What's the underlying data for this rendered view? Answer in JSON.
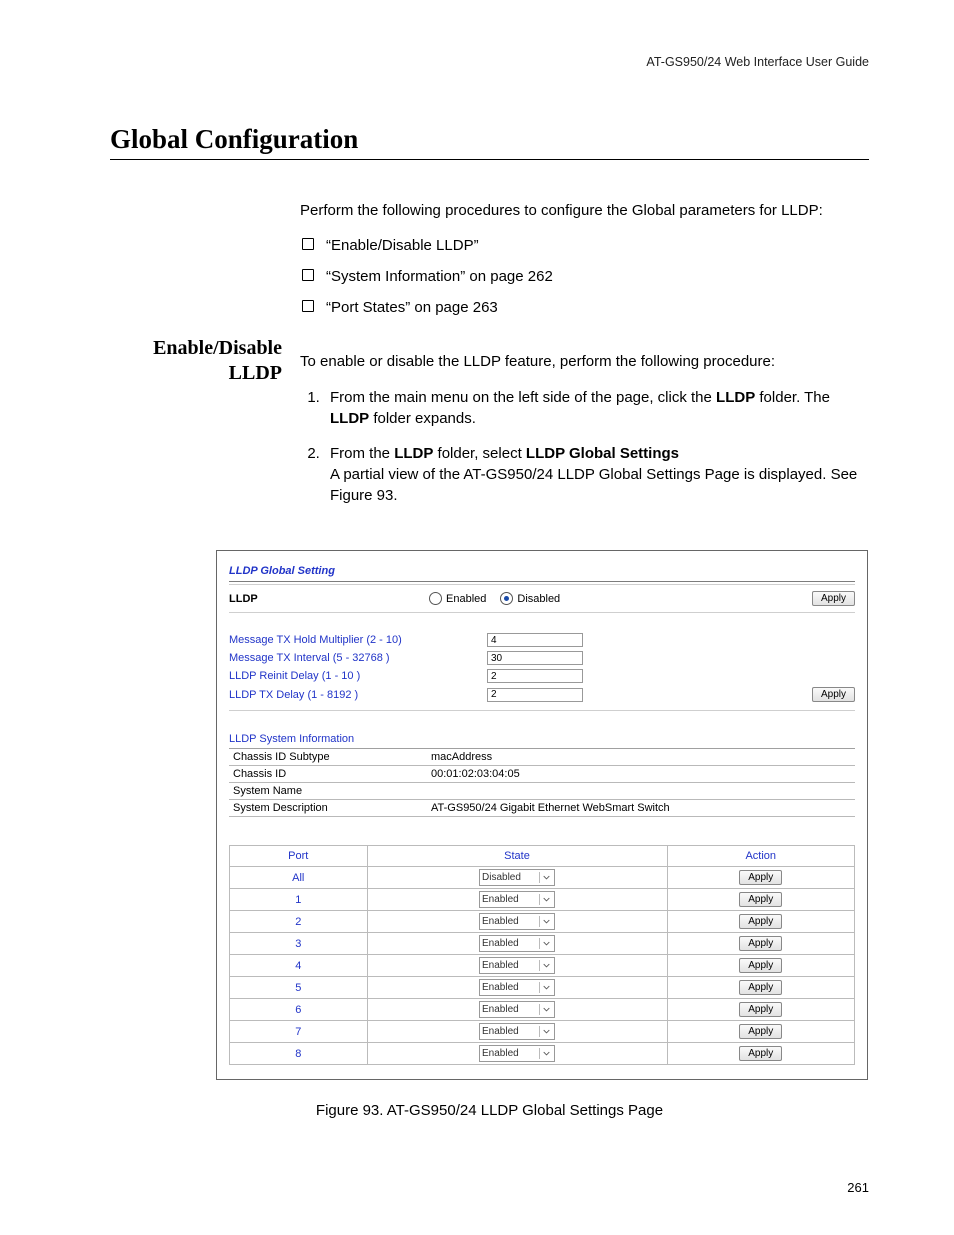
{
  "header": {
    "doc_title": "AT-GS950/24  Web Interface User Guide"
  },
  "title": "Global Configuration",
  "intro": "Perform the following procedures to configure the Global parameters for LLDP:",
  "xref_list": [
    "“Enable/Disable LLDP”",
    "“System Information” on page 262",
    "“Port States” on page 263"
  ],
  "section_heading": "Enable/Disable LLDP",
  "section_intro": "To enable or disable the LLDP feature, perform the following procedure:",
  "steps": [
    {
      "pre": "From the main menu on the left side of the page, click the ",
      "b1": "LLDP",
      "mid1": " folder. The ",
      "b2": "LLDP",
      "mid2": " folder expands."
    },
    {
      "pre": "From the ",
      "b1": "LLDP",
      "mid1": " folder, select ",
      "b2": "LLDP Global Settings",
      "tail": "A partial view of the AT-GS950/24 LLDP Global Settings Page is displayed. See Figure 93."
    }
  ],
  "figure": {
    "panel_title": "LLDP Global Setting",
    "lldp_label": "LLDP",
    "radio_enabled": "Enabled",
    "radio_disabled": "Disabled",
    "apply_label": "Apply",
    "params": [
      {
        "label": "Message TX Hold Multiplier   (2 - 10)",
        "value": "4"
      },
      {
        "label": "Message TX Interval   (5 - 32768 )",
        "value": "30"
      },
      {
        "label": "LLDP Reinit Delay   (1 - 10 )",
        "value": "2"
      },
      {
        "label": "LLDP TX Delay   (1 - 8192 )",
        "value": "2"
      }
    ],
    "sysinfo_title": "LLDP System Information",
    "sysinfo": [
      {
        "k": "Chassis ID Subtype",
        "v": "macAddress"
      },
      {
        "k": "Chassis ID",
        "v": "00:01:02:03:04:05"
      },
      {
        "k": "System Name",
        "v": ""
      },
      {
        "k": "System Description",
        "v": "AT-GS950/24 Gigabit Ethernet WebSmart Switch"
      }
    ],
    "ports": {
      "headers": {
        "port": "Port",
        "state": "State",
        "action": "Action"
      },
      "rows": [
        {
          "port": "All",
          "state": "Disabled"
        },
        {
          "port": "1",
          "state": "Enabled"
        },
        {
          "port": "2",
          "state": "Enabled"
        },
        {
          "port": "3",
          "state": "Enabled"
        },
        {
          "port": "4",
          "state": "Enabled"
        },
        {
          "port": "5",
          "state": "Enabled"
        },
        {
          "port": "6",
          "state": "Enabled"
        },
        {
          "port": "7",
          "state": "Enabled"
        },
        {
          "port": "8",
          "state": "Enabled"
        }
      ]
    }
  },
  "figure_caption": "Figure 93. AT-GS950/24 LLDP Global Settings Page",
  "page_number": "261"
}
